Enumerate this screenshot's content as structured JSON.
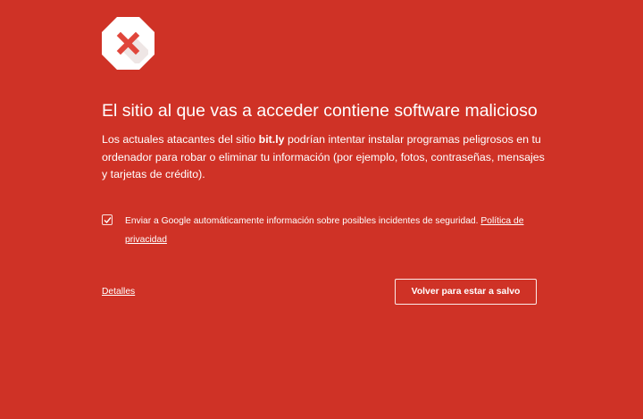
{
  "colors": {
    "background": "#cf3226",
    "text": "#ffffff",
    "icon_octagon": "#ffffff",
    "icon_cross": "#e0463b"
  },
  "icon": "danger-octagon-cross-icon",
  "heading": "El sitio al que vas a acceder contiene software malicioso",
  "body": {
    "before": "Los actuales atacantes del sitio ",
    "site": "bit.ly",
    "after": " podrían intentar instalar programas peligrosos en tu ordenador para robar o eliminar tu información (por ejemplo, fotos, contraseñas, mensajes y tarjetas de crédito)."
  },
  "opt_in": {
    "checked": true,
    "text": "Enviar a Google automáticamente información sobre posibles incidentes de seguridad. ",
    "link": "Política de privacidad"
  },
  "details_link": "Detalles",
  "primary_button": "Volver para estar a salvo"
}
